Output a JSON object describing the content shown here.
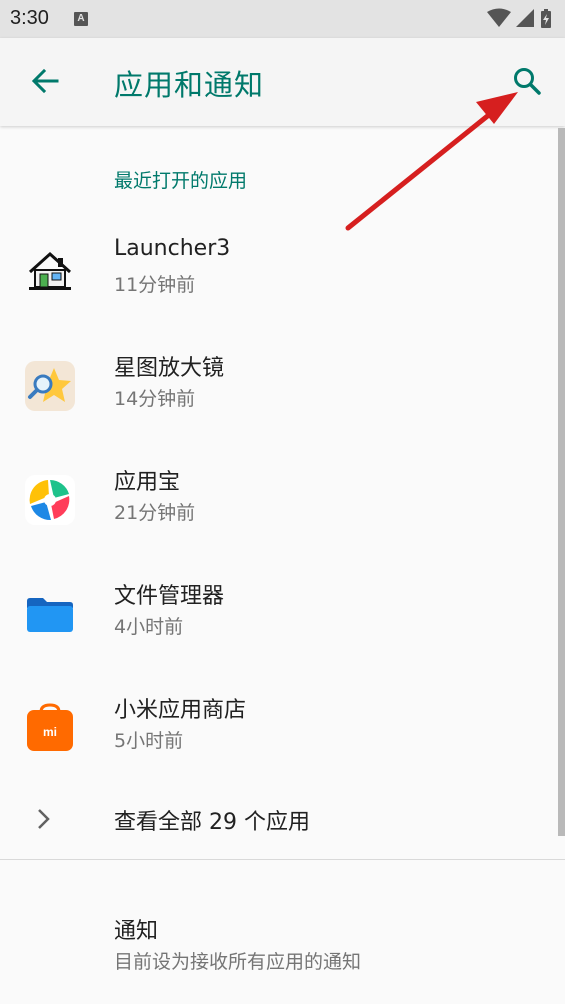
{
  "status_bar": {
    "time": "3:30",
    "notification_badge": "A"
  },
  "header": {
    "title": "应用和通知",
    "back_icon": "arrow-back-icon",
    "search_icon": "search-icon"
  },
  "section_title": "最近打开的应用",
  "recent_apps": [
    {
      "name": "Launcher3",
      "time": "11分钟前",
      "icon": "house-icon"
    },
    {
      "name": "星图放大镜",
      "time": "14分钟前",
      "icon": "star-magnifier-icon"
    },
    {
      "name": "应用宝",
      "time": "21分钟前",
      "icon": "app-store-icon"
    },
    {
      "name": "文件管理器",
      "time": "4小时前",
      "icon": "folder-icon"
    },
    {
      "name": "小米应用商店",
      "time": "5小时前",
      "icon": "mi-store-icon"
    }
  ],
  "see_all": "查看全部 29 个应用",
  "notifications": {
    "title": "通知",
    "summary": "目前设为接收所有应用的通知"
  },
  "colors": {
    "accent": "#00796b",
    "annotation_arrow": "#d61f1f"
  }
}
